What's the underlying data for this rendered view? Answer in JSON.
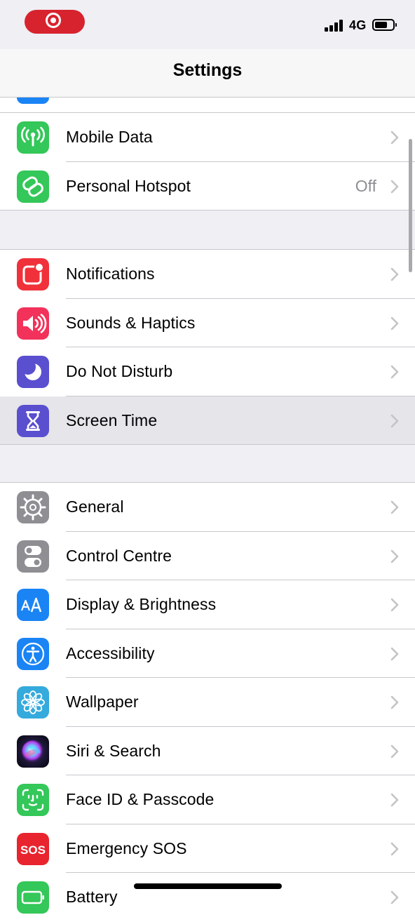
{
  "status_bar": {
    "network": "4G"
  },
  "nav": {
    "title": "Settings"
  },
  "groups": [
    {
      "rows": [
        {
          "label": "Mobile Data",
          "icon": "antenna-icon",
          "color": "#34c759"
        },
        {
          "label": "Personal Hotspot",
          "value": "Off",
          "icon": "hotspot-link-icon",
          "color": "#34c759"
        }
      ]
    },
    {
      "rows": [
        {
          "label": "Notifications",
          "icon": "notifications-icon",
          "color": "#f0303a"
        },
        {
          "label": "Sounds & Haptics",
          "icon": "speaker-icon",
          "color": "#f2325a"
        },
        {
          "label": "Do Not Disturb",
          "icon": "moon-icon",
          "color": "#5a4fcf"
        },
        {
          "label": "Screen Time",
          "icon": "hourglass-icon",
          "color": "#5a4fcf",
          "selected": true
        }
      ]
    },
    {
      "rows": [
        {
          "label": "General",
          "icon": "gear-icon",
          "color": "#8e8e93"
        },
        {
          "label": "Control Centre",
          "icon": "toggles-icon",
          "color": "#8e8e93"
        },
        {
          "label": "Display & Brightness",
          "icon": "text-size-icon",
          "color": "#1a84f5"
        },
        {
          "label": "Accessibility",
          "icon": "accessibility-icon",
          "color": "#1a84f5"
        },
        {
          "label": "Wallpaper",
          "icon": "flower-icon",
          "color": "#35aadc"
        },
        {
          "label": "Siri & Search",
          "icon": "siri-icon",
          "color": "#1c1c2e"
        },
        {
          "label": "Face ID & Passcode",
          "icon": "face-id-icon",
          "color": "#34c759"
        },
        {
          "label": "Emergency SOS",
          "icon": "sos-icon",
          "color": "#e8242e",
          "icon_text": "SOS"
        },
        {
          "label": "Battery",
          "icon": "battery-icon",
          "color": "#34c759"
        }
      ]
    }
  ]
}
